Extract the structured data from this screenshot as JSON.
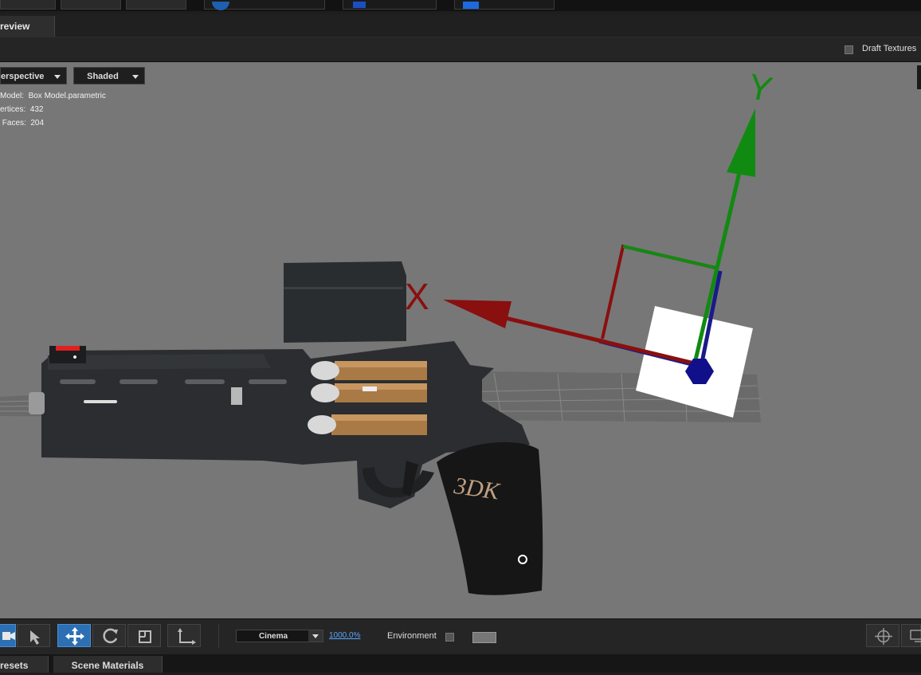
{
  "tabs": {
    "preview": "review"
  },
  "options": {
    "draft_textures_label": "Draft Textures"
  },
  "viewport": {
    "projection": "erspective",
    "shading": "Shaded",
    "stats": {
      "model_label": "Model:",
      "model_value": "Box Model.parametric",
      "vertices_label": "ertices:",
      "vertices_value": "432",
      "faces_label": "Faces:",
      "faces_value": "204"
    },
    "gizmo": {
      "x_label": "X",
      "y_label": "Y",
      "x_color": "#8a0f0f",
      "y_color": "#118a11",
      "z_color": "#1a1a8a"
    },
    "grip_text": "3DK"
  },
  "toolbar": {
    "render_mode": "Cinema",
    "zoom": "1000.0%",
    "environment_label": "Environment"
  },
  "bottom_tabs": {
    "presets": "resets",
    "scene_materials": "Scene Materials"
  }
}
